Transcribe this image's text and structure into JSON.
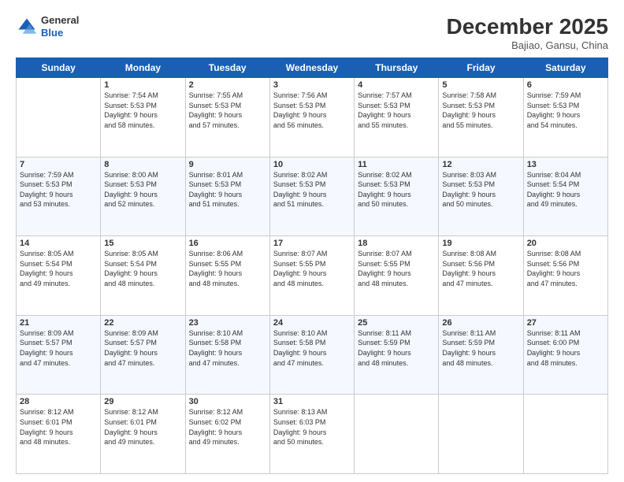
{
  "header": {
    "logo_general": "General",
    "logo_blue": "Blue",
    "month_title": "December 2025",
    "location": "Bajiao, Gansu, China"
  },
  "days_of_week": [
    "Sunday",
    "Monday",
    "Tuesday",
    "Wednesday",
    "Thursday",
    "Friday",
    "Saturday"
  ],
  "weeks": [
    [
      {
        "day": "",
        "info": ""
      },
      {
        "day": "1",
        "info": "Sunrise: 7:54 AM\nSunset: 5:53 PM\nDaylight: 9 hours\nand 58 minutes."
      },
      {
        "day": "2",
        "info": "Sunrise: 7:55 AM\nSunset: 5:53 PM\nDaylight: 9 hours\nand 57 minutes."
      },
      {
        "day": "3",
        "info": "Sunrise: 7:56 AM\nSunset: 5:53 PM\nDaylight: 9 hours\nand 56 minutes."
      },
      {
        "day": "4",
        "info": "Sunrise: 7:57 AM\nSunset: 5:53 PM\nDaylight: 9 hours\nand 55 minutes."
      },
      {
        "day": "5",
        "info": "Sunrise: 7:58 AM\nSunset: 5:53 PM\nDaylight: 9 hours\nand 55 minutes."
      },
      {
        "day": "6",
        "info": "Sunrise: 7:59 AM\nSunset: 5:53 PM\nDaylight: 9 hours\nand 54 minutes."
      }
    ],
    [
      {
        "day": "7",
        "info": "Sunrise: 7:59 AM\nSunset: 5:53 PM\nDaylight: 9 hours\nand 53 minutes."
      },
      {
        "day": "8",
        "info": "Sunrise: 8:00 AM\nSunset: 5:53 PM\nDaylight: 9 hours\nand 52 minutes."
      },
      {
        "day": "9",
        "info": "Sunrise: 8:01 AM\nSunset: 5:53 PM\nDaylight: 9 hours\nand 51 minutes."
      },
      {
        "day": "10",
        "info": "Sunrise: 8:02 AM\nSunset: 5:53 PM\nDaylight: 9 hours\nand 51 minutes."
      },
      {
        "day": "11",
        "info": "Sunrise: 8:02 AM\nSunset: 5:53 PM\nDaylight: 9 hours\nand 50 minutes."
      },
      {
        "day": "12",
        "info": "Sunrise: 8:03 AM\nSunset: 5:53 PM\nDaylight: 9 hours\nand 50 minutes."
      },
      {
        "day": "13",
        "info": "Sunrise: 8:04 AM\nSunset: 5:54 PM\nDaylight: 9 hours\nand 49 minutes."
      }
    ],
    [
      {
        "day": "14",
        "info": "Sunrise: 8:05 AM\nSunset: 5:54 PM\nDaylight: 9 hours\nand 49 minutes."
      },
      {
        "day": "15",
        "info": "Sunrise: 8:05 AM\nSunset: 5:54 PM\nDaylight: 9 hours\nand 48 minutes."
      },
      {
        "day": "16",
        "info": "Sunrise: 8:06 AM\nSunset: 5:55 PM\nDaylight: 9 hours\nand 48 minutes."
      },
      {
        "day": "17",
        "info": "Sunrise: 8:07 AM\nSunset: 5:55 PM\nDaylight: 9 hours\nand 48 minutes."
      },
      {
        "day": "18",
        "info": "Sunrise: 8:07 AM\nSunset: 5:55 PM\nDaylight: 9 hours\nand 48 minutes."
      },
      {
        "day": "19",
        "info": "Sunrise: 8:08 AM\nSunset: 5:56 PM\nDaylight: 9 hours\nand 47 minutes."
      },
      {
        "day": "20",
        "info": "Sunrise: 8:08 AM\nSunset: 5:56 PM\nDaylight: 9 hours\nand 47 minutes."
      }
    ],
    [
      {
        "day": "21",
        "info": "Sunrise: 8:09 AM\nSunset: 5:57 PM\nDaylight: 9 hours\nand 47 minutes."
      },
      {
        "day": "22",
        "info": "Sunrise: 8:09 AM\nSunset: 5:57 PM\nDaylight: 9 hours\nand 47 minutes."
      },
      {
        "day": "23",
        "info": "Sunrise: 8:10 AM\nSunset: 5:58 PM\nDaylight: 9 hours\nand 47 minutes."
      },
      {
        "day": "24",
        "info": "Sunrise: 8:10 AM\nSunset: 5:58 PM\nDaylight: 9 hours\nand 47 minutes."
      },
      {
        "day": "25",
        "info": "Sunrise: 8:11 AM\nSunset: 5:59 PM\nDaylight: 9 hours\nand 48 minutes."
      },
      {
        "day": "26",
        "info": "Sunrise: 8:11 AM\nSunset: 5:59 PM\nDaylight: 9 hours\nand 48 minutes."
      },
      {
        "day": "27",
        "info": "Sunrise: 8:11 AM\nSunset: 6:00 PM\nDaylight: 9 hours\nand 48 minutes."
      }
    ],
    [
      {
        "day": "28",
        "info": "Sunrise: 8:12 AM\nSunset: 6:01 PM\nDaylight: 9 hours\nand 48 minutes."
      },
      {
        "day": "29",
        "info": "Sunrise: 8:12 AM\nSunset: 6:01 PM\nDaylight: 9 hours\nand 49 minutes."
      },
      {
        "day": "30",
        "info": "Sunrise: 8:12 AM\nSunset: 6:02 PM\nDaylight: 9 hours\nand 49 minutes."
      },
      {
        "day": "31",
        "info": "Sunrise: 8:13 AM\nSunset: 6:03 PM\nDaylight: 9 hours\nand 50 minutes."
      },
      {
        "day": "",
        "info": ""
      },
      {
        "day": "",
        "info": ""
      },
      {
        "day": "",
        "info": ""
      }
    ]
  ]
}
